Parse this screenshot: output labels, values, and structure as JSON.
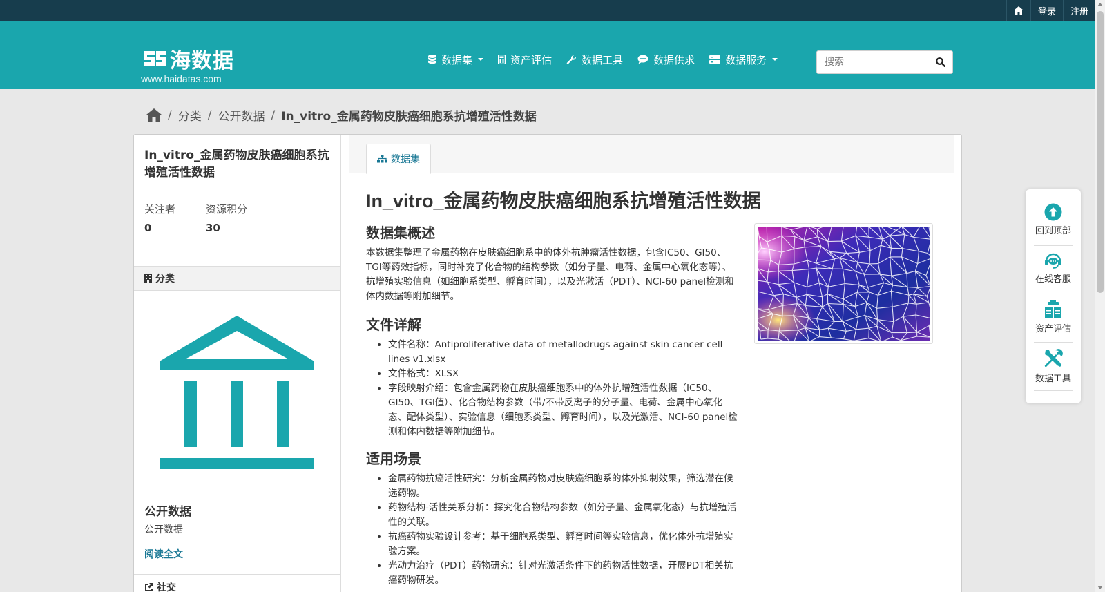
{
  "account_bar": {
    "login": "登录",
    "register": "注册"
  },
  "site": {
    "name": "海数据",
    "url": "www.haidatas.com"
  },
  "nav": {
    "items": [
      {
        "label": "数据集",
        "icon": "database-icon",
        "dropdown": true
      },
      {
        "label": "资产评估",
        "icon": "calculator-icon",
        "dropdown": false
      },
      {
        "label": "数据工具",
        "icon": "wrench-icon",
        "dropdown": false
      },
      {
        "label": "数据供求",
        "icon": "chat-icon",
        "dropdown": false
      },
      {
        "label": "数据服务",
        "icon": "server-icon",
        "dropdown": true
      }
    ],
    "search_placeholder": "搜索"
  },
  "breadcrumb": {
    "items": [
      "分类",
      "公开数据"
    ],
    "current": "In_vitro_金属药物皮肤癌细胞系抗增殖活性数据"
  },
  "sidebar": {
    "title": "In_vitro_金属药物皮肤癌细胞系抗增殖活性数据",
    "followers_label": "关注者",
    "followers_value": "0",
    "points_label": "资源积分",
    "points_value": "30",
    "category_heading": "分类",
    "org_name": "公开数据",
    "org_description": "公开数据",
    "read_more": "阅读全文",
    "social_heading": "社交"
  },
  "tab": {
    "label": "数据集"
  },
  "dataset": {
    "title": "In_vitro_金属药物皮肤癌细胞系抗增殖活性数据",
    "overview_heading": "数据集概述",
    "overview_text": "本数据集整理了金属药物在皮肤癌细胞系中的体外抗肿瘤活性数据，包含IC50、GI50、TGI等药效指标，同时补充了化合物的结构参数（如分子量、电荷、金属中心氧化态等）、抗增殖实验信息（如细胞系类型、孵育时间），以及光激活（PDT）、NCI-60 panel检测和体内数据等附加细节。",
    "file_heading": "文件详解",
    "file_items": [
      "文件名称：Antiproliferative data of metallodrugs against skin cancer cell lines v1.xlsx",
      "文件格式：XLSX",
      "字段映射介绍：包含金属药物在皮肤癌细胞系中的体外抗增殖活性数据（IC50、GI50、TGI值）、化合物结构参数（带/不带反离子的分子量、电荷、金属中心氧化态、配体类型）、实验信息（细胞系类型、孵育时间），以及光激活、NCI-60 panel检测和体内数据等附加细节。"
    ],
    "usage_heading": "适用场景",
    "usage_items": [
      "金属药物抗癌活性研究：分析金属药物对皮肤癌细胞系的体外抑制效果，筛选潜在候选药物。",
      "药物结构-活性关系分析：探究化合物结构参数（如分子量、金属氧化态）与抗增殖活性的关联。",
      "抗癌药物实验设计参考：基于细胞系类型、孵育时间等实验信息，优化体外抗增殖实验方案。",
      "光动力治疗（PDT）药物研究：针对光激活条件下的药物活性数据，开展PDT相关抗癌药物研发。"
    ]
  },
  "float_bar": {
    "items": [
      {
        "label": "回到顶部",
        "icon": "arrow-up-circle-icon"
      },
      {
        "label": "在线客服",
        "icon": "headset-icon"
      },
      {
        "label": "资产评估",
        "icon": "clipboard-icon"
      },
      {
        "label": "数据工具",
        "icon": "tools-icon"
      }
    ]
  },
  "colors": {
    "account_bar": "#173d4d",
    "masthead": "#1aa6ad",
    "accent": "#1aa6ad",
    "link": "#187794"
  }
}
